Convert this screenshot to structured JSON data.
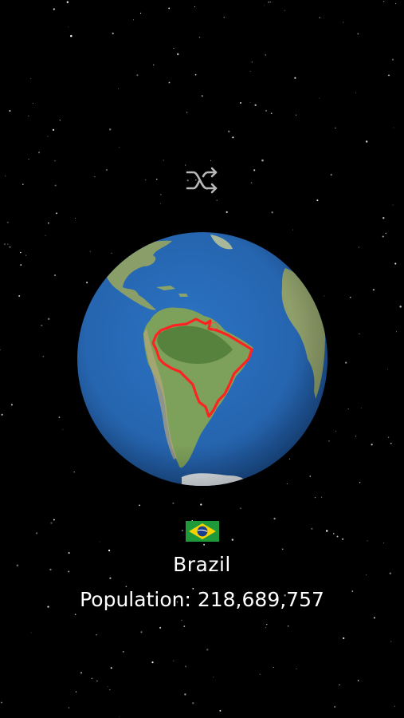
{
  "background_color": "#000000",
  "shuffle": {
    "icon": "shuffle-icon",
    "color": "#b8b8b8"
  },
  "globe": {
    "focus_country": "Brazil",
    "ocean_color": "#2f6fb8",
    "land_color": "#6f9a4e",
    "highlight_color": "#ff2020"
  },
  "country": {
    "flag_icon": "brazil-flag-icon",
    "name": "Brazil",
    "population_label": "Population:",
    "population_value": "218,689,757"
  }
}
